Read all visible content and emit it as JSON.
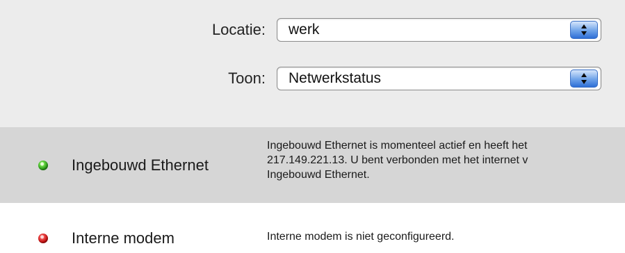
{
  "location": {
    "label": "Locatie:",
    "value": "werk"
  },
  "show": {
    "label": "Toon:",
    "value": "Netwerkstatus"
  },
  "services": [
    {
      "name": "Ingebouwd Ethernet",
      "status": "active",
      "status_color": "#3fbf2a",
      "description": [
        "Ingebouwd Ethernet is momenteel actief en heeft het",
        "217.149.221.13. U bent verbonden met het internet v",
        "Ingebouwd Ethernet."
      ]
    },
    {
      "name": "Interne modem",
      "status": "not-configured",
      "status_color": "#d42020",
      "description": [
        "Interne modem is niet geconfigureerd."
      ]
    }
  ]
}
